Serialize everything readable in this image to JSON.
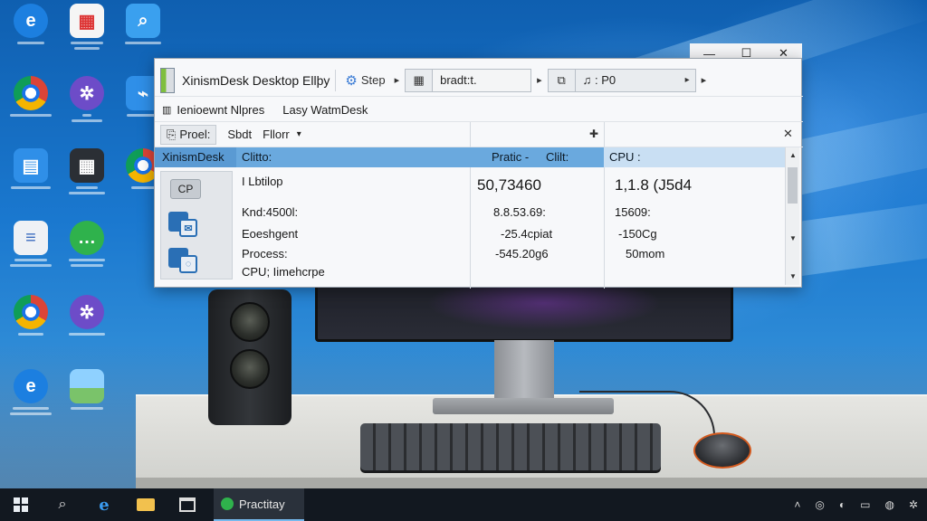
{
  "window": {
    "title": "XinismDesk Desktop Ellþy",
    "controls": {
      "minimize": "—",
      "maximize": "☐",
      "close": "✕"
    }
  },
  "toolbar": {
    "step_label": "Step",
    "field_1_value": "bradt:t.",
    "field_2_value": "♫ : P0"
  },
  "breadcrumb": {
    "item_1": "Ienioewnt Nlpres",
    "item_2": "Lasy WatmDesk"
  },
  "filters": {
    "proc_label": "Proel:",
    "sbdt_label": "Sbdt",
    "filter_label": "Fllorr"
  },
  "table": {
    "left_header": "XinismDesk",
    "headers": [
      "Clitto:",
      "Pratic -",
      "Clilt:",
      "CPU :"
    ],
    "side_chip": "CP",
    "rows": [
      {
        "c1": "I Lbtilop",
        "c2": "50,73460",
        "c3": "1,1.8 (J5d4"
      },
      {
        "c1": "Knd:4500l:",
        "c2": "8.8.53.69:",
        "c3": "15609:"
      },
      {
        "c1": "Eoeshgent",
        "c2": "-25.4cpiat",
        "c3": "-150Cg"
      },
      {
        "c1": "Process:",
        "c2": "-545.20g6",
        "c3": "50mom"
      },
      {
        "c1": "CPU; Iimehcrpe",
        "c2": "",
        "c3": ""
      }
    ]
  },
  "taskbar": {
    "active_app": "Practitay"
  },
  "colors": {
    "header_blue": "#6aa9de",
    "desktop_blue": "#1266b8",
    "taskbar": "#121820"
  }
}
